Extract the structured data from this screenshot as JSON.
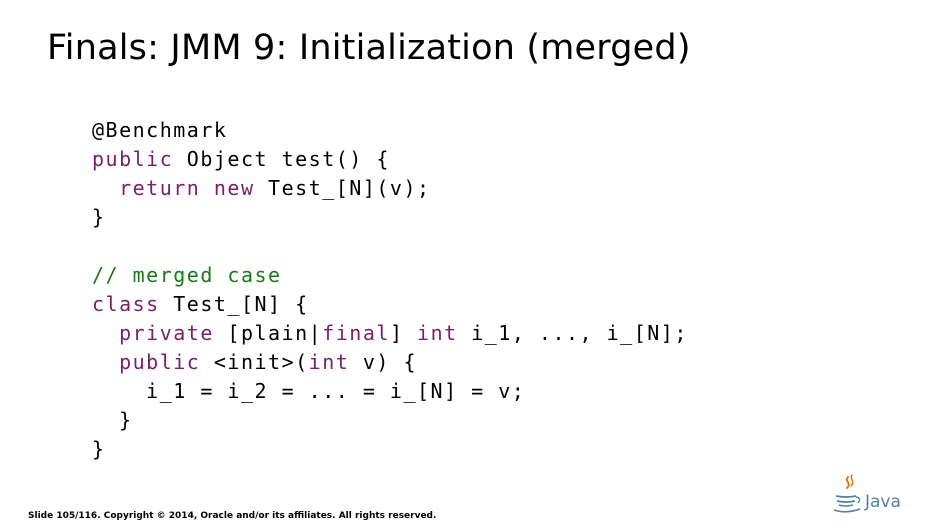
{
  "slide": {
    "title": "Finals: JMM 9: Initialization (merged)",
    "footer": "Slide 105/116. Copyright © 2014, Oracle and/or its affiliates. All rights reserved.",
    "logo_text": "Java",
    "logo_icon": "java-coffee-cup-icon"
  },
  "code": {
    "lines": [
      [
        {
          "t": "@Benchmark",
          "k": "plain"
        }
      ],
      [
        {
          "t": "public",
          "k": "kw"
        },
        {
          "t": " Object test() {",
          "k": "plain"
        }
      ],
      [
        {
          "t": "  ",
          "k": "plain"
        },
        {
          "t": "return",
          "k": "kw"
        },
        {
          "t": " ",
          "k": "plain"
        },
        {
          "t": "new",
          "k": "kw"
        },
        {
          "t": " Test_[N](v);",
          "k": "plain"
        }
      ],
      [
        {
          "t": "}",
          "k": "plain"
        }
      ],
      [
        {
          "t": "",
          "k": "plain"
        }
      ],
      [
        {
          "t": "// merged case",
          "k": "cm"
        }
      ],
      [
        {
          "t": "class",
          "k": "kw"
        },
        {
          "t": " Test_[N] {",
          "k": "plain"
        }
      ],
      [
        {
          "t": "  ",
          "k": "plain"
        },
        {
          "t": "private",
          "k": "kw"
        },
        {
          "t": " [plain|",
          "k": "plain"
        },
        {
          "t": "final",
          "k": "kw"
        },
        {
          "t": "] ",
          "k": "plain"
        },
        {
          "t": "int",
          "k": "kw"
        },
        {
          "t": " i_1, ..., i_[N];",
          "k": "plain"
        }
      ],
      [
        {
          "t": "  ",
          "k": "plain"
        },
        {
          "t": "public",
          "k": "kw"
        },
        {
          "t": " <init>(",
          "k": "plain"
        },
        {
          "t": "int",
          "k": "kw"
        },
        {
          "t": " v) {",
          "k": "plain"
        }
      ],
      [
        {
          "t": "    i_1 = i_2 = ... = i_[N] = v;",
          "k": "plain"
        }
      ],
      [
        {
          "t": "  }",
          "k": "plain"
        }
      ],
      [
        {
          "t": "}",
          "k": "plain"
        }
      ]
    ]
  },
  "colors": {
    "keyword": "#7a1f6a",
    "comment": "#1a7a1a",
    "text": "#000000",
    "logo_blue": "#5382a1",
    "logo_orange": "#e76f00"
  }
}
